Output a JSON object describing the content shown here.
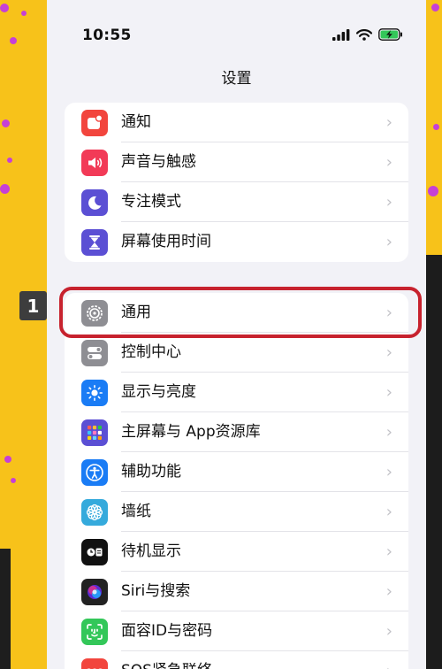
{
  "status_bar": {
    "time": "10:55"
  },
  "nav": {
    "title": "设置"
  },
  "annotation": {
    "step_number": "1"
  },
  "groups": [
    {
      "items": [
        {
          "label": "通知",
          "icon": "notification-icon",
          "color": "#f2453d"
        },
        {
          "label": "声音与触感",
          "icon": "speaker-icon",
          "color": "#f23a57"
        },
        {
          "label": "专注模式",
          "icon": "moon-icon",
          "color": "#5b4fd4"
        },
        {
          "label": "屏幕使用时间",
          "icon": "hourglass-icon",
          "color": "#5b4fd4"
        }
      ]
    },
    {
      "items": [
        {
          "label": "通用",
          "icon": "gear-icon",
          "color": "#8e8e93"
        },
        {
          "label": "控制中心",
          "icon": "toggles-icon",
          "color": "#8e8e93"
        },
        {
          "label": "显示与亮度",
          "icon": "sun-icon",
          "color": "#1a7cf5"
        },
        {
          "label": "主屏幕与 App资源库",
          "icon": "app-grid-icon",
          "color": "#5b4fd4"
        },
        {
          "label": "辅助功能",
          "icon": "accessibility-icon",
          "color": "#1a7cf5"
        },
        {
          "label": "墙纸",
          "icon": "flower-icon",
          "color": "#35aadc"
        },
        {
          "label": "待机显示",
          "icon": "standby-icon",
          "color": "#111111"
        },
        {
          "label": "Siri与搜索",
          "icon": "siri-icon",
          "color": "#222222"
        },
        {
          "label": "面容ID与密码",
          "icon": "face-id-icon",
          "color": "#33c759"
        },
        {
          "label": "SOS紧急联络",
          "icon": "sos-icon",
          "color": "#f2453d"
        }
      ]
    }
  ]
}
